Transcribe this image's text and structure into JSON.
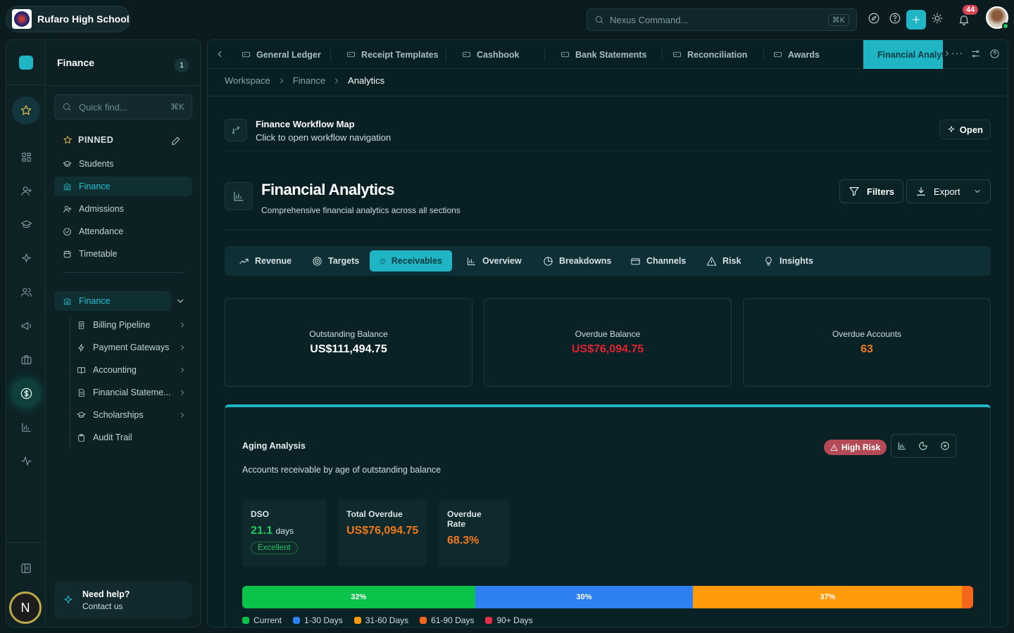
{
  "app": {
    "school_name": "Rufaro High School",
    "command_placeholder": "Nexus Command...",
    "command_kbd": "⌘K",
    "notifications": "44",
    "avatar_letter": "N"
  },
  "sidebar": {
    "title": "Finance",
    "count": "1",
    "search_placeholder": "Quick find...",
    "search_kbd": "⌘K",
    "pinned_label": "PINNED",
    "pinned": [
      "Students",
      "Finance",
      "Admissions",
      "Attendance",
      "Timetable"
    ],
    "group_label": "Finance",
    "sub_items": [
      "Billing Pipeline",
      "Payment Gateways",
      "Accounting",
      "Financial Stateme...",
      "Scholarships",
      "Audit Trail"
    ],
    "help_title": "Need help?",
    "help_sub": "Contact us"
  },
  "tabs": [
    "General Ledger",
    "Receipt Templates",
    "Cashbook",
    "Bank Statements",
    "Reconciliation",
    "Awards",
    "Financial Analyt"
  ],
  "breadcrumb": [
    "Workspace",
    "Finance",
    "Analytics"
  ],
  "workflow": {
    "title": "Finance Workflow Map",
    "subtitle": "Click to open workflow navigation",
    "open": "Open"
  },
  "page": {
    "title": "Financial Analytics",
    "subtitle": "Comprehensive financial analytics across all sections",
    "filters": "Filters",
    "export": "Export"
  },
  "subtabs": [
    "Revenue",
    "Targets",
    "Receivables",
    "Overview",
    "Breakdowns",
    "Channels",
    "Risk",
    "Insights"
  ],
  "kpis": [
    {
      "label": "Outstanding Balance",
      "value": "US$111,494.75",
      "color": "#ffffff"
    },
    {
      "label": "Overdue Balance",
      "value": "US$76,094.75",
      "color": "#e0242f"
    },
    {
      "label": "Overdue Accounts",
      "value": "63",
      "color": "#f07a18"
    }
  ],
  "aging": {
    "title": "Aging Analysis",
    "subtitle": "Accounts receivable by age of outstanding balance",
    "risk": "High Risk",
    "dso_label": "DSO",
    "dso_value": "21.1",
    "dso_unit": "days",
    "dso_badge": "Excellent",
    "overdue_label": "Total Overdue",
    "overdue_value": "US$76,094.75",
    "rate_label": "Overdue Rate",
    "rate_value": "68.3%"
  },
  "chart_data": {
    "type": "bar",
    "categories": [
      "Current",
      "1-30 Days",
      "31-60 Days",
      "61-90 Days",
      "90+ Days"
    ],
    "values": [
      32,
      30,
      37,
      1.5,
      0
    ],
    "labels": [
      "32%",
      "30%",
      "37%",
      "",
      ""
    ],
    "colors": [
      "#0bc24a",
      "#2f80f0",
      "#ff9a0a",
      "#f5661d",
      "#e5304a"
    ]
  }
}
